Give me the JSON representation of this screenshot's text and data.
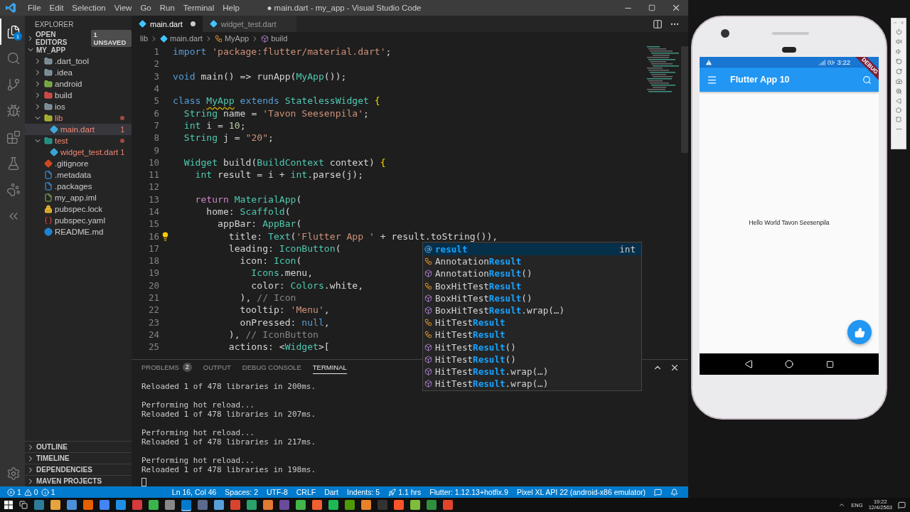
{
  "title_bar": {
    "menus": [
      "File",
      "Edit",
      "Selection",
      "View",
      "Go",
      "Run",
      "Terminal",
      "Help"
    ],
    "title": "● main.dart - my_app - Visual Studio Code"
  },
  "activity_bar": {
    "items": [
      {
        "kind": "files",
        "selected": true,
        "badge": "1"
      },
      {
        "kind": "search",
        "selected": false
      },
      {
        "kind": "scm",
        "selected": false
      },
      {
        "kind": "debug",
        "selected": false
      },
      {
        "kind": "extensions",
        "selected": false
      },
      {
        "kind": "testing",
        "selected": false
      },
      {
        "kind": "paw",
        "selected": false
      },
      {
        "kind": "flutter",
        "selected": false
      }
    ],
    "bottom": [
      {
        "kind": "settings",
        "selected": false
      }
    ]
  },
  "sidebar": {
    "title": "EXPLORER",
    "open_editors": {
      "label": "OPEN EDITORS",
      "badge": "1 UNSAVED",
      "expanded": false
    },
    "project": {
      "label": "MY_APP",
      "expanded": true,
      "items": [
        {
          "label": ".dart_tool",
          "kind": "folder",
          "expanded": false,
          "error": false,
          "selected": false
        },
        {
          "label": ".idea",
          "kind": "folder",
          "expanded": false,
          "error": false,
          "selected": false
        },
        {
          "label": "android",
          "kind": "android",
          "expanded": false,
          "error": false,
          "selected": false
        },
        {
          "label": "build",
          "kind": "build",
          "expanded": false,
          "error": false,
          "selected": false
        },
        {
          "label": "ios",
          "kind": "folder",
          "expanded": false,
          "error": false,
          "selected": false
        },
        {
          "label": "lib",
          "kind": "lib",
          "expanded": true,
          "error": true,
          "selected": false,
          "children": [
            {
              "label": "main.dart",
              "kind": "dart",
              "error": true,
              "problems": "1",
              "selected": true
            }
          ]
        },
        {
          "label": "test",
          "kind": "test",
          "expanded": true,
          "error": true,
          "selected": false,
          "children": [
            {
              "label": "widget_test.dart",
              "kind": "dart",
              "error": true,
              "problems": "1",
              "selected": false
            }
          ]
        },
        {
          "label": ".gitignore",
          "kind": "git",
          "error": false,
          "selected": false
        },
        {
          "label": ".metadata",
          "kind": "doc",
          "error": false,
          "selected": false
        },
        {
          "label": ".packages",
          "kind": "doc",
          "error": false,
          "selected": false
        },
        {
          "label": "my_app.iml",
          "kind": "iml",
          "error": false,
          "selected": false
        },
        {
          "label": "pubspec.lock",
          "kind": "lock",
          "error": false,
          "selected": false
        },
        {
          "label": "pubspec.yaml",
          "kind": "yaml",
          "error": false,
          "selected": false
        },
        {
          "label": "README.md",
          "kind": "info",
          "error": false,
          "selected": false
        }
      ]
    },
    "sections": [
      {
        "label": "OUTLINE",
        "expanded": false
      },
      {
        "label": "TIMELINE",
        "expanded": false
      },
      {
        "label": "DEPENDENCIES",
        "expanded": false
      },
      {
        "label": "MAVEN PROJECTS",
        "expanded": false
      }
    ]
  },
  "editor": {
    "tabs": [
      {
        "label": "main.dart",
        "selected": true,
        "dirty": true
      },
      {
        "label": "widget_test.dart",
        "selected": false,
        "dirty": false
      }
    ],
    "breadcrumbs": [
      {
        "kind": "folder",
        "label": "lib"
      },
      {
        "kind": "dart",
        "label": "main.dart"
      },
      {
        "kind": "class",
        "label": "MyApp"
      },
      {
        "kind": "method",
        "label": "build"
      }
    ],
    "lines": [
      {
        "number": "1",
        "tokens": [
          {
            "kind": "kw",
            "text": "import "
          },
          {
            "kind": "str",
            "text": "'package:flutter/material.dart'"
          },
          {
            "kind": "plain",
            "text": ";"
          }
        ]
      },
      {
        "number": "2"
      },
      {
        "number": "3",
        "tokens": [
          {
            "kind": "kw",
            "text": "void "
          },
          {
            "kind": "plain",
            "text": "main() => runApp("
          },
          {
            "kind": "type",
            "text": "MyApp"
          },
          {
            "kind": "plain",
            "text": "());"
          }
        ]
      },
      {
        "number": "4"
      },
      {
        "number": "5",
        "tokens": [
          {
            "kind": "kw",
            "text": "class "
          },
          {
            "kind": "warn",
            "text": "MyApp"
          },
          {
            "kind": "kw",
            "text": " extends "
          },
          {
            "kind": "type",
            "text": "StatelessWidget "
          },
          {
            "kind": "brace",
            "text": "{"
          }
        ]
      },
      {
        "number": "6",
        "tokens": [
          {
            "kind": "type",
            "text": "  String"
          },
          {
            "kind": "plain",
            "text": " name = "
          },
          {
            "kind": "str",
            "text": "'Tavon Seesenpila'"
          },
          {
            "kind": "plain",
            "text": ";"
          }
        ]
      },
      {
        "number": "7",
        "tokens": [
          {
            "kind": "type",
            "text": "  int"
          },
          {
            "kind": "plain",
            "text": " i = "
          },
          {
            "kind": "num",
            "text": "10"
          },
          {
            "kind": "plain",
            "text": ";"
          }
        ]
      },
      {
        "number": "8",
        "tokens": [
          {
            "kind": "type",
            "text": "  String"
          },
          {
            "kind": "plain",
            "text": " j = "
          },
          {
            "kind": "str",
            "text": "\"20\""
          },
          {
            "kind": "plain",
            "text": ";"
          }
        ]
      },
      {
        "number": "9"
      },
      {
        "number": "10",
        "tokens": [
          {
            "kind": "type",
            "text": "  Widget"
          },
          {
            "kind": "plain",
            "text": " build("
          },
          {
            "kind": "type",
            "text": "BuildContext"
          },
          {
            "kind": "plain",
            "text": " context) "
          },
          {
            "kind": "brace",
            "text": "{"
          }
        ]
      },
      {
        "number": "11",
        "tokens": [
          {
            "kind": "type",
            "text": "    int"
          },
          {
            "kind": "plain",
            "text": " result = i + "
          },
          {
            "kind": "type",
            "text": "int"
          },
          {
            "kind": "plain",
            "text": ".parse(j);"
          }
        ]
      },
      {
        "number": "12"
      },
      {
        "number": "13",
        "tokens": [
          {
            "kind": "ctrl",
            "text": "    return "
          },
          {
            "kind": "type",
            "text": "MaterialApp"
          },
          {
            "kind": "plain",
            "text": "("
          }
        ]
      },
      {
        "number": "14",
        "tokens": [
          {
            "kind": "plain",
            "text": "      home: "
          },
          {
            "kind": "type",
            "text": "Scaffold"
          },
          {
            "kind": "plain",
            "text": "("
          }
        ]
      },
      {
        "number": "15",
        "tokens": [
          {
            "kind": "plain",
            "text": "        appBar: "
          },
          {
            "kind": "type",
            "text": "AppBar"
          },
          {
            "kind": "plain",
            "text": "("
          }
        ]
      },
      {
        "number": "16",
        "lightbulb": true,
        "tokens": [
          {
            "kind": "plain",
            "text": "          title: "
          },
          {
            "kind": "type",
            "text": "Text"
          },
          {
            "kind": "plain",
            "text": "("
          },
          {
            "kind": "str",
            "text": "'Flutter App '"
          },
          {
            "kind": "plain",
            "text": " + result.toString()),"
          }
        ]
      },
      {
        "number": "17",
        "tokens": [
          {
            "kind": "plain",
            "text": "          leading: "
          },
          {
            "kind": "type",
            "text": "IconButton"
          },
          {
            "kind": "plain",
            "text": "("
          }
        ]
      },
      {
        "number": "18",
        "tokens": [
          {
            "kind": "plain",
            "text": "            icon: "
          },
          {
            "kind": "type",
            "text": "Icon"
          },
          {
            "kind": "plain",
            "text": "("
          }
        ]
      },
      {
        "number": "19",
        "tokens": [
          {
            "kind": "type",
            "text": "              Icons"
          },
          {
            "kind": "plain",
            "text": ".menu,"
          }
        ]
      },
      {
        "number": "20",
        "tokens": [
          {
            "kind": "plain",
            "text": "              color: "
          },
          {
            "kind": "type",
            "text": "Colors"
          },
          {
            "kind": "plain",
            "text": ".white,"
          }
        ]
      },
      {
        "number": "21",
        "tokens": [
          {
            "kind": "plain",
            "text": "            ), "
          },
          {
            "kind": "comment",
            "text": "// Icon"
          }
        ]
      },
      {
        "number": "22",
        "tokens": [
          {
            "kind": "plain",
            "text": "            tooltip: "
          },
          {
            "kind": "str",
            "text": "'Menu'"
          },
          {
            "kind": "plain",
            "text": ","
          }
        ]
      },
      {
        "number": "23",
        "tokens": [
          {
            "kind": "plain",
            "text": "            onPressed: "
          },
          {
            "kind": "kw",
            "text": "null"
          },
          {
            "kind": "plain",
            "text": ","
          }
        ]
      },
      {
        "number": "24",
        "tokens": [
          {
            "kind": "plain",
            "text": "          ), "
          },
          {
            "kind": "comment",
            "text": "// IconButton"
          }
        ]
      },
      {
        "number": "25",
        "tokens": [
          {
            "kind": "plain",
            "text": "          actions: <"
          },
          {
            "kind": "type",
            "text": "Widget"
          },
          {
            "kind": "plain",
            "text": ">["
          }
        ]
      }
    ],
    "suggestions": [
      {
        "kind": "variable",
        "match": "result",
        "detail": "int",
        "selected": true
      },
      {
        "kind": "class",
        "pre": "Annotation",
        "match": "Result",
        "selected": false
      },
      {
        "kind": "constructor",
        "pre": "Annotation",
        "match": "Result",
        "post": "()",
        "selected": false
      },
      {
        "kind": "class",
        "pre": "BoxHitTest",
        "match": "Result",
        "selected": false
      },
      {
        "kind": "constructor",
        "pre": "BoxHitTest",
        "match": "Result",
        "post": "()",
        "selected": false
      },
      {
        "kind": "constructor",
        "pre": "BoxHitTest",
        "match": "Result",
        "post": ".wrap(…)",
        "selected": false
      },
      {
        "kind": "class",
        "pre": "HitTest",
        "match": "Result",
        "selected": false
      },
      {
        "kind": "class",
        "pre": "HitTest",
        "match": "Result",
        "selected": false
      },
      {
        "kind": "constructor",
        "pre": "HitTest",
        "match": "Result",
        "post": "()",
        "selected": false
      },
      {
        "kind": "constructor",
        "pre": "HitTest",
        "match": "Result",
        "post": "()",
        "selected": false
      },
      {
        "kind": "constructor",
        "pre": "HitTest",
        "match": "Result",
        "post": ".wrap(…)",
        "selected": false
      },
      {
        "kind": "constructor",
        "pre": "HitTest",
        "match": "Result",
        "post": ".wrap(…)",
        "selected": false
      }
    ]
  },
  "panel": {
    "tabs": [
      {
        "label": "PROBLEMS",
        "badge": "2",
        "selected": false
      },
      {
        "label": "OUTPUT",
        "selected": false
      },
      {
        "label": "DEBUG CONSOLE",
        "selected": false
      },
      {
        "label": "TERMINAL",
        "selected": true
      }
    ],
    "terminal_blocks": [
      [
        "Reloaded 1 of 478 libraries in 200ms."
      ],
      [
        "Performing hot reload...",
        "Reloaded 1 of 478 libraries in 207ms."
      ],
      [
        "Performing hot reload...",
        "Reloaded 1 of 478 libraries in 217ms."
      ],
      [
        "Performing hot reload...",
        "Reloaded 1 of 478 libraries in 198ms."
      ]
    ]
  },
  "status_bar": {
    "problems": [
      {
        "kind": "error",
        "count": "1"
      },
      {
        "kind": "warning",
        "count": "0"
      },
      {
        "kind": "info",
        "count": "1"
      }
    ],
    "items": [
      {
        "kind": "text",
        "label": "Ln 16, Col 46"
      },
      {
        "kind": "text",
        "label": "Spaces: 2"
      },
      {
        "kind": "text",
        "label": "UTF-8"
      },
      {
        "kind": "text",
        "label": "CRLF"
      },
      {
        "kind": "text",
        "label": "Dart"
      },
      {
        "kind": "text",
        "label": "Indents: 5"
      },
      {
        "kind": "rocket",
        "label": "1.1 hrs"
      },
      {
        "kind": "text",
        "label": "Flutter: 1.12.13+hotfix.9"
      },
      {
        "kind": "text",
        "label": "Pixel XL API 22 (android-x86 emulator)"
      },
      {
        "kind": "feedback"
      },
      {
        "kind": "bell"
      }
    ]
  },
  "emulator": {
    "status_time": "3:22",
    "debug_banner": "DEBUG",
    "app_title": "Flutter App 10",
    "body_text": "Hello World Tavon Seesenpila"
  },
  "taskbar": {
    "language": "ENG",
    "time": "19:22",
    "date": "12/4/2563"
  }
}
